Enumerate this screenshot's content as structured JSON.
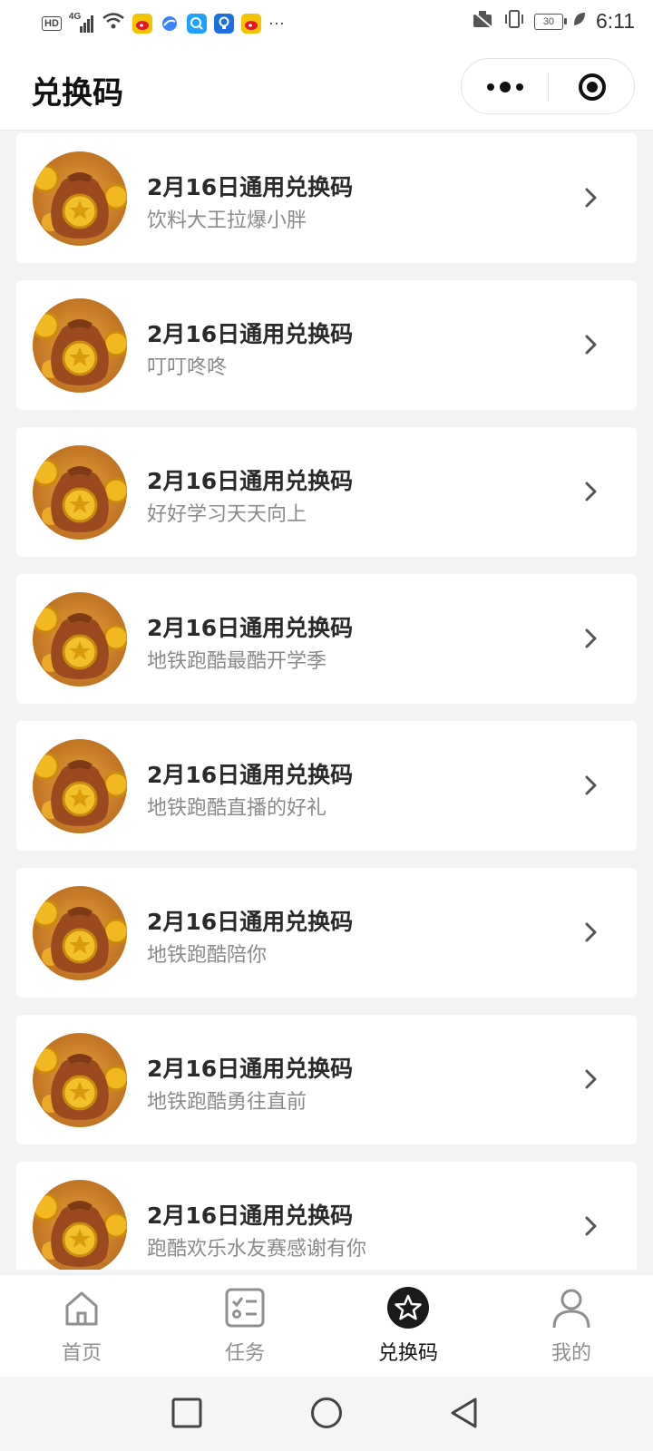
{
  "status_bar": {
    "hd_badge": "HD",
    "network": "4G",
    "battery": "30",
    "time": "6:11",
    "more": "···",
    "icons": [
      "signal-icon",
      "wifi-icon",
      "weibo-icon",
      "browser-icon",
      "search-app-icon",
      "bulb-app-icon",
      "weibo-icon",
      "battery-icon",
      "vibrate-icon",
      "silent-icon",
      "leaf-icon"
    ]
  },
  "header": {
    "title": "兑换码",
    "more_icon": "more-dots-icon",
    "close_icon": "target-icon"
  },
  "list": {
    "items": [
      {
        "title": "2月16日通用兑换码",
        "subtitle": "饮料大王拉爆小胖"
      },
      {
        "title": "2月16日通用兑换码",
        "subtitle": "叮叮咚咚"
      },
      {
        "title": "2月16日通用兑换码",
        "subtitle": "好好学习天天向上"
      },
      {
        "title": "2月16日通用兑换码",
        "subtitle": "地铁跑酷最酷开学季"
      },
      {
        "title": "2月16日通用兑换码",
        "subtitle": "地铁跑酷直播的好礼"
      },
      {
        "title": "2月16日通用兑换码",
        "subtitle": "地铁跑酷陪你"
      },
      {
        "title": "2月16日通用兑换码",
        "subtitle": "地铁跑酷勇往直前"
      },
      {
        "title": "2月16日通用兑换码",
        "subtitle": "跑酷欢乐水友赛感谢有你"
      }
    ]
  },
  "tabbar": {
    "tabs": [
      {
        "label": "首页",
        "icon": "home-icon",
        "active": false
      },
      {
        "label": "任务",
        "icon": "task-list-icon",
        "active": false
      },
      {
        "label": "兑换码",
        "icon": "star-icon",
        "active": true
      },
      {
        "label": "我的",
        "icon": "user-icon",
        "active": false
      }
    ]
  },
  "system_nav": {
    "icons": [
      "square-icon",
      "circle-icon",
      "back-triangle-icon"
    ]
  },
  "colors": {
    "background": "#f2f3f5",
    "card": "#ffffff",
    "title_text": "#2a2a2a",
    "subtitle_text": "#8a8a8a",
    "tab_inactive": "#8f8f8f",
    "tab_active": "#111111",
    "coin_gold": "#f2b81f",
    "bag_brown": "#9a4a1e"
  }
}
